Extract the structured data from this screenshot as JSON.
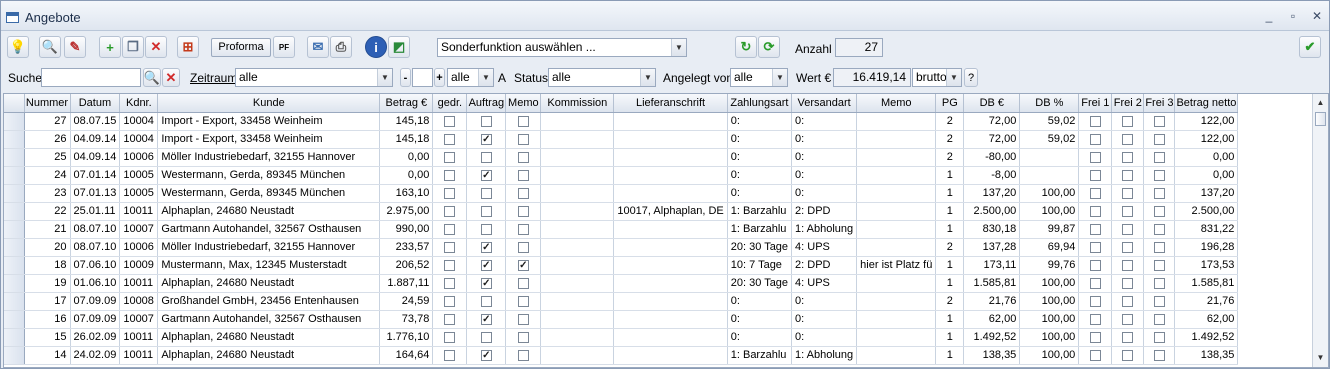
{
  "window": {
    "title": "Angebote",
    "minimize": "_",
    "restore": "▫",
    "close": "✕"
  },
  "toolbar": {
    "proforma_label": "Proforma",
    "pdf_label": "PF",
    "special_function": "Sonderfunktion auswählen ...",
    "count_label": "Anzahl",
    "count_value": "27"
  },
  "filters": {
    "search_label": "Suche",
    "search_value": "",
    "period_label": "Zeitraum",
    "period_value": "alle",
    "minus_label": "-",
    "plus_label": "+",
    "all_value": "alle",
    "a_label": "A",
    "status_label": "Status",
    "status_value": "alle",
    "offered_by_label": "Angelegt von",
    "offered_by_value": "alle",
    "value_label": "Wert €",
    "value_amount": "16.419,14",
    "value_mode": "brutto",
    "help_label": "?"
  },
  "table": {
    "columns": [
      "Nummer",
      "Datum",
      "Kdnr.",
      "Kunde",
      "Betrag €",
      "gedr.",
      "Auftrag",
      "Memo",
      "Kommission",
      "Lieferanschrift",
      "Zahlungsart",
      "Versandart",
      "Memo",
      "PG",
      "DB €",
      "DB %",
      "Frei 1",
      "Frei 2",
      "Frei 3",
      "Betrag netto"
    ],
    "rows": [
      {
        "nummer": "27",
        "datum": "08.07.15",
        "kdnr": "10004",
        "kunde": "Import - Export, 33458 Weinheim",
        "betrag": "145,18",
        "gedr": false,
        "auftrag": false,
        "memo": false,
        "kommission": "",
        "liefer": "",
        "zahlung": "0:",
        "versand": "0:",
        "memo2": "",
        "pg": "2",
        "db": "72,00",
        "dbp": "59,02",
        "f1": false,
        "f2": false,
        "f3": false,
        "netto": "122,00"
      },
      {
        "nummer": "26",
        "datum": "04.09.14",
        "kdnr": "10004",
        "kunde": "Import - Export, 33458 Weinheim",
        "betrag": "145,18",
        "gedr": false,
        "auftrag": true,
        "memo": false,
        "kommission": "",
        "liefer": "",
        "zahlung": "0:",
        "versand": "0:",
        "memo2": "",
        "pg": "2",
        "db": "72,00",
        "dbp": "59,02",
        "f1": false,
        "f2": false,
        "f3": false,
        "netto": "122,00"
      },
      {
        "nummer": "25",
        "datum": "04.09.14",
        "kdnr": "10006",
        "kunde": "Möller Industriebedarf, 32155 Hannover",
        "betrag": "0,00",
        "gedr": false,
        "auftrag": false,
        "memo": false,
        "kommission": "",
        "liefer": "",
        "zahlung": "0:",
        "versand": "0:",
        "memo2": "",
        "pg": "2",
        "db": "-80,00",
        "dbp": "",
        "f1": false,
        "f2": false,
        "f3": false,
        "netto": "0,00"
      },
      {
        "nummer": "24",
        "datum": "07.01.14",
        "kdnr": "10005",
        "kunde": "Westermann, Gerda, 89345 München",
        "betrag": "0,00",
        "gedr": false,
        "auftrag": true,
        "memo": false,
        "kommission": "",
        "liefer": "",
        "zahlung": "0:",
        "versand": "0:",
        "memo2": "",
        "pg": "1",
        "db": "-8,00",
        "dbp": "",
        "f1": false,
        "f2": false,
        "f3": false,
        "netto": "0,00"
      },
      {
        "nummer": "23",
        "datum": "07.01.13",
        "kdnr": "10005",
        "kunde": "Westermann, Gerda, 89345 München",
        "betrag": "163,10",
        "gedr": false,
        "auftrag": false,
        "memo": false,
        "kommission": "",
        "liefer": "",
        "zahlung": "0:",
        "versand": "0:",
        "memo2": "",
        "pg": "1",
        "db": "137,20",
        "dbp": "100,00",
        "f1": false,
        "f2": false,
        "f3": false,
        "netto": "137,20"
      },
      {
        "nummer": "22",
        "datum": "25.01.11",
        "kdnr": "10011",
        "kunde": "Alphaplan, 24680 Neustadt",
        "betrag": "2.975,00",
        "gedr": false,
        "auftrag": false,
        "memo": false,
        "kommission": "",
        "liefer": "10017, Alphaplan, DE",
        "zahlung": "1: Barzahlu",
        "versand": "2: DPD",
        "memo2": "",
        "pg": "1",
        "db": "2.500,00",
        "dbp": "100,00",
        "f1": false,
        "f2": false,
        "f3": false,
        "netto": "2.500,00"
      },
      {
        "nummer": "21",
        "datum": "08.07.10",
        "kdnr": "10007",
        "kunde": "Gartmann Autohandel, 32567 Osthausen",
        "betrag": "990,00",
        "gedr": false,
        "auftrag": false,
        "memo": false,
        "kommission": "",
        "liefer": "",
        "zahlung": "1: Barzahlu",
        "versand": "1: Abholung",
        "memo2": "",
        "pg": "1",
        "db": "830,18",
        "dbp": "99,87",
        "f1": false,
        "f2": false,
        "f3": false,
        "netto": "831,22"
      },
      {
        "nummer": "20",
        "datum": "08.07.10",
        "kdnr": "10006",
        "kunde": "Möller Industriebedarf, 32155 Hannover",
        "betrag": "233,57",
        "gedr": false,
        "auftrag": true,
        "memo": false,
        "kommission": "",
        "liefer": "",
        "zahlung": "20: 30 Tage",
        "versand": "4: UPS",
        "memo2": "",
        "pg": "2",
        "db": "137,28",
        "dbp": "69,94",
        "f1": false,
        "f2": false,
        "f3": false,
        "netto": "196,28"
      },
      {
        "nummer": "18",
        "datum": "07.06.10",
        "kdnr": "10009",
        "kunde": "Mustermann, Max, 12345 Musterstadt",
        "betrag": "206,52",
        "gedr": false,
        "auftrag": true,
        "memo": true,
        "kommission": "",
        "liefer": "",
        "zahlung": "10: 7 Tage",
        "versand": "2: DPD",
        "memo2": "hier ist Platz fü",
        "pg": "1",
        "db": "173,11",
        "dbp": "99,76",
        "f1": false,
        "f2": false,
        "f3": false,
        "netto": "173,53"
      },
      {
        "nummer": "19",
        "datum": "01.06.10",
        "kdnr": "10011",
        "kunde": "Alphaplan, 24680 Neustadt",
        "betrag": "1.887,11",
        "gedr": false,
        "auftrag": true,
        "memo": false,
        "kommission": "",
        "liefer": "",
        "zahlung": "20: 30 Tage",
        "versand": "4: UPS",
        "memo2": "",
        "pg": "1",
        "db": "1.585,81",
        "dbp": "100,00",
        "f1": false,
        "f2": false,
        "f3": false,
        "netto": "1.585,81"
      },
      {
        "nummer": "17",
        "datum": "07.09.09",
        "kdnr": "10008",
        "kunde": "Großhandel GmbH, 23456 Entenhausen",
        "betrag": "24,59",
        "gedr": false,
        "auftrag": false,
        "memo": false,
        "kommission": "",
        "liefer": "",
        "zahlung": "0:",
        "versand": "0:",
        "memo2": "",
        "pg": "2",
        "db": "21,76",
        "dbp": "100,00",
        "f1": false,
        "f2": false,
        "f3": false,
        "netto": "21,76"
      },
      {
        "nummer": "16",
        "datum": "07.09.09",
        "kdnr": "10007",
        "kunde": "Gartmann Autohandel, 32567 Osthausen",
        "betrag": "73,78",
        "gedr": false,
        "auftrag": true,
        "memo": false,
        "kommission": "",
        "liefer": "",
        "zahlung": "0:",
        "versand": "0:",
        "memo2": "",
        "pg": "1",
        "db": "62,00",
        "dbp": "100,00",
        "f1": false,
        "f2": false,
        "f3": false,
        "netto": "62,00"
      },
      {
        "nummer": "15",
        "datum": "26.02.09",
        "kdnr": "10011",
        "kunde": "Alphaplan, 24680 Neustadt",
        "betrag": "1.776,10",
        "gedr": false,
        "auftrag": false,
        "memo": false,
        "kommission": "",
        "liefer": "",
        "zahlung": "0:",
        "versand": "0:",
        "memo2": "",
        "pg": "1",
        "db": "1.492,52",
        "dbp": "100,00",
        "f1": false,
        "f2": false,
        "f3": false,
        "netto": "1.492,52"
      },
      {
        "nummer": "14",
        "datum": "24.02.09",
        "kdnr": "10011",
        "kunde": "Alphaplan, 24680 Neustadt",
        "betrag": "164,64",
        "gedr": false,
        "auftrag": true,
        "memo": false,
        "kommission": "",
        "liefer": "",
        "zahlung": "1: Barzahlu",
        "versand": "1: Abholung",
        "memo2": "",
        "pg": "1",
        "db": "138,35",
        "dbp": "100,00",
        "f1": false,
        "f2": false,
        "f3": false,
        "netto": "138,35"
      }
    ]
  }
}
